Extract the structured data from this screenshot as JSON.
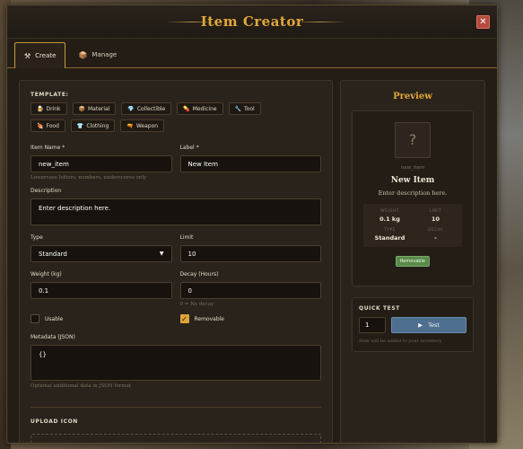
{
  "window": {
    "title": "Item Creator",
    "close_label": "✕"
  },
  "tabs": [
    {
      "label": "Create",
      "icon": "⚒"
    },
    {
      "label": "Manage",
      "icon": "📦"
    }
  ],
  "form": {
    "template_label": "TEMPLATE:",
    "templates": [
      {
        "label": "Drink",
        "icon": "🍺"
      },
      {
        "label": "Material",
        "icon": "📦"
      },
      {
        "label": "Collectible",
        "icon": "💎"
      },
      {
        "label": "Medicine",
        "icon": "💊"
      },
      {
        "label": "Tool",
        "icon": "🔧"
      },
      {
        "label": "Food",
        "icon": "🍖"
      },
      {
        "label": "Clothing",
        "icon": "👕"
      },
      {
        "label": "Weapon",
        "icon": "🔫"
      }
    ],
    "item_name": {
      "label": "Item Name *",
      "value": "new_item",
      "hint": "Lowercase letters, numbers, underscores only"
    },
    "item_label": {
      "label": "Label *",
      "value": "New Item"
    },
    "description": {
      "label": "Description",
      "value": "Enter description here."
    },
    "type": {
      "label": "Type",
      "value": "Standard"
    },
    "limit": {
      "label": "Limit",
      "value": "10"
    },
    "weight": {
      "label": "Weight (kg)",
      "value": "0.1"
    },
    "decay": {
      "label": "Decay (Hours)",
      "value": "0",
      "hint": "0 = No decay"
    },
    "usable": {
      "label": "Usable",
      "checked": false
    },
    "removable": {
      "label": "Removable",
      "checked": true
    },
    "metadata": {
      "label": "Metadata (JSON)",
      "value": "{}",
      "hint": "Optional additional data in JSON format"
    },
    "upload_label": "UPLOAD ICON"
  },
  "preview": {
    "title": "Preview",
    "icon_placeholder": "?",
    "name": "new_item",
    "label": "New Item",
    "description": "Enter description here.",
    "stats": {
      "weight_key": "WEIGHT",
      "weight_val": "0.1 kg",
      "limit_key": "LIMIT",
      "limit_val": "10",
      "type_key": "TYPE",
      "type_val": "Standard",
      "decay_key": "DECAY",
      "decay_val": "-"
    },
    "badge": "Removable"
  },
  "quick_test": {
    "label": "QUICK TEST",
    "qty": "1",
    "button_label": "Test",
    "hint": "Item will be added to your inventory"
  }
}
